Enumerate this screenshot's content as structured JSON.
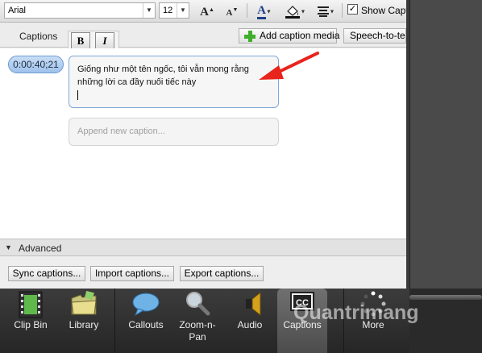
{
  "toolbar": {
    "font_family": "Arial",
    "font_size": "12",
    "grow_font_label": "A",
    "shrink_font_label": "A",
    "font_color_label": "A",
    "show_captions_label": "Show Captions",
    "show_captions_checked": true
  },
  "format": {
    "bold_label": "B",
    "italic_label": "I"
  },
  "captions_bar": {
    "title": "Captions",
    "add_media_label": "Add caption media",
    "speech_label": "Speech-to-text"
  },
  "caption": {
    "timecode": "0:00:40;21",
    "text": "Giống như một tên ngốc, tôi vẫn mong rằng những lời ca đầy nuối tiếc này",
    "append_placeholder": "Append new caption..."
  },
  "advanced": {
    "label": "Advanced",
    "sync_label": "Sync captions...",
    "import_label": "Import captions...",
    "export_label": "Export captions..."
  },
  "tabs": [
    {
      "label": "Clip Bin",
      "icon": "film-strip-icon"
    },
    {
      "label": "Library",
      "icon": "folder-icon"
    },
    {
      "label": "Callouts",
      "icon": "speech-bubble-icon"
    },
    {
      "label": "Zoom-n-\nPan",
      "icon": "magnifier-icon"
    },
    {
      "label": "Audio",
      "icon": "speaker-icon"
    },
    {
      "label": "Captions",
      "icon": "cc-icon"
    },
    {
      "label": "More",
      "icon": "spinner-icon"
    }
  ],
  "watermark": "Quantrimang",
  "colors": {
    "annotation_arrow": "#e8241c",
    "timecode": "#b4d1f2",
    "accent": "#7fa9d9"
  }
}
